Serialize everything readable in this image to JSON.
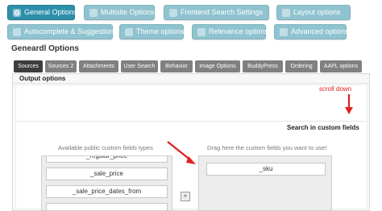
{
  "top_tabs": [
    {
      "label": "General Options",
      "icon": "gear-icon",
      "active": true
    },
    {
      "label": "Multisite Options",
      "icon": "network-icon",
      "active": false
    },
    {
      "label": "Frontend Search Settings",
      "icon": "window-icon",
      "active": false
    },
    {
      "label": "Layout options",
      "icon": "layout-icon",
      "active": false
    },
    {
      "label": "Autocomplete & Suggestions",
      "icon": "location-pin-icon",
      "active": false
    },
    {
      "label": "Theme options",
      "icon": "eye-icon",
      "active": false
    },
    {
      "label": "Relevance options",
      "icon": "bars-icon",
      "active": false
    },
    {
      "label": "Advanced options",
      "icon": "wrench-icon",
      "active": false
    }
  ],
  "section_title": "Geneardl Options",
  "sub_tabs": [
    {
      "label": "Sources",
      "active": true
    },
    {
      "label": "Sources 2",
      "active": false
    },
    {
      "label": "Attachments",
      "active": false
    },
    {
      "label": "User Search",
      "active": false
    },
    {
      "label": "Behavior",
      "active": false
    },
    {
      "label": "Image Options",
      "active": false
    },
    {
      "label": "BuddyPress",
      "active": false
    },
    {
      "label": "Ordering",
      "active": false
    },
    {
      "label": "AAPL options",
      "active": false
    }
  ],
  "panel_title": "Output options",
  "annotation_scroll": "scroll down",
  "search_fields_title": "Search in custom fields",
  "available_header": "Available public custom fields types",
  "drop_header": "Drag here the custom fields you want to use!",
  "available_fields": [
    "_regular_price",
    "_sale_price",
    "_sale_price_dates_from",
    ""
  ],
  "selected_fields": [
    "_sku"
  ],
  "move_button": "«",
  "colors": {
    "active_tab": "#2d8fa9",
    "inactive_tab": "#8fc3cf",
    "annotation_red": "#e02020"
  }
}
